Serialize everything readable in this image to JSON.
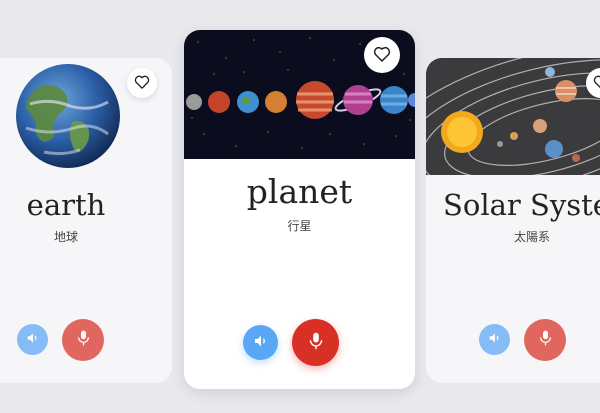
{
  "cards": {
    "left": {
      "word": "earth",
      "translation": "地球"
    },
    "center": {
      "word": "planet",
      "translation": "行星"
    },
    "right": {
      "word": "Solar System",
      "translation": "太陽系"
    }
  },
  "icons": {
    "favorite": "heart-icon",
    "speaker": "speaker-icon",
    "mic": "microphone-icon"
  },
  "colors": {
    "background": "#e8e8ed",
    "speaker_button": "#5aa7f5",
    "mic_button": "#d93025"
  }
}
